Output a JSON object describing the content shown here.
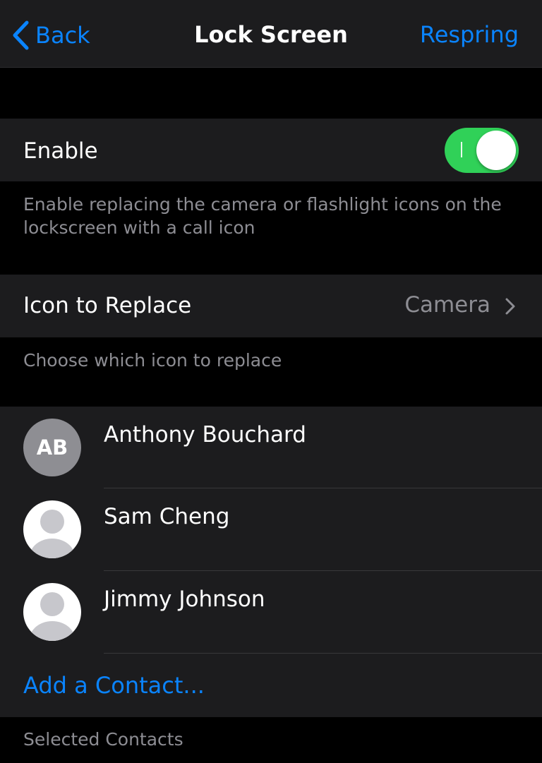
{
  "nav": {
    "back_label": "Back",
    "title": "Lock Screen",
    "action_label": "Respring"
  },
  "enable": {
    "label": "Enable",
    "toggle_on": true,
    "footer": "Enable replacing the camera or flashlight icons on the lockscreen with a call icon"
  },
  "icon_replace": {
    "label": "Icon to Replace",
    "value": "Camera",
    "footer": "Choose which icon to replace"
  },
  "contacts": {
    "items": [
      {
        "name": "Anthony Bouchard",
        "initials": "AB",
        "avatar": "initials"
      },
      {
        "name": "Sam Cheng",
        "avatar": "person-placeholder-icon"
      },
      {
        "name": "Jimmy Johnson",
        "avatar": "person-placeholder-icon"
      }
    ],
    "add_label": "Add a Contact...",
    "footer": "Selected Contacts"
  },
  "colors": {
    "background": "#000000",
    "cell": "#1c1c1e",
    "accent": "#0a84ff",
    "toggle_on": "#30d158",
    "secondary_text": "#8d8d93"
  }
}
